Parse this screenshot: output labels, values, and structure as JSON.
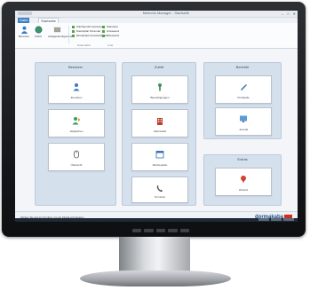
{
  "window": {
    "title": "Metechs Manager - Startseite",
    "controls": {
      "minimize": "–",
      "maximize": "□",
      "close": "✕"
    }
  },
  "menu": {
    "file_tab": "Datei",
    "active_tab": "Startseite"
  },
  "ribbon": {
    "buttons": [
      {
        "label": "Benutzer",
        "icon": "user-icon"
      },
      {
        "label": "Zutritt",
        "icon": "globe-icon"
      },
      {
        "label": "Anlagenkonfiguration",
        "icon": "settings-icon"
      }
    ],
    "list_a": [
      "Zutrittsprofil zuordnen",
      "Dienstplan Personal",
      "Einsatzplan Ausweisdaten"
    ],
    "list_b": [
      "Standorte",
      "Anwesend",
      "Abwesend"
    ],
    "groups": [
      "Datensätze",
      "Liste"
    ]
  },
  "panels": {
    "left": {
      "title": "Benutzer",
      "tiles": [
        "Zuordnen",
        "Abgleichen",
        "Übersicht"
      ]
    },
    "middle": {
      "title": "Zutritt",
      "tiles": [
        "Berechtigungen",
        "Zeitmodell",
        "Wochenplan",
        "Terminen"
      ]
    },
    "right_top": {
      "title": "Berichte",
      "tiles": [
        "Protokolle",
        "Journal"
      ]
    },
    "right_bottom": {
      "title": "Extras",
      "tiles": [
        "Hinweis"
      ]
    }
  },
  "status": {
    "message": "Klicken Sie auf ein Symbol, um ein Modul anzuzeigen"
  },
  "brand": {
    "name": "dormakaba",
    "accent": "#d52b1e"
  },
  "monitor": {
    "buttons": [
      "MENU",
      "AUTO",
      "–",
      "+",
      "⏻"
    ]
  }
}
